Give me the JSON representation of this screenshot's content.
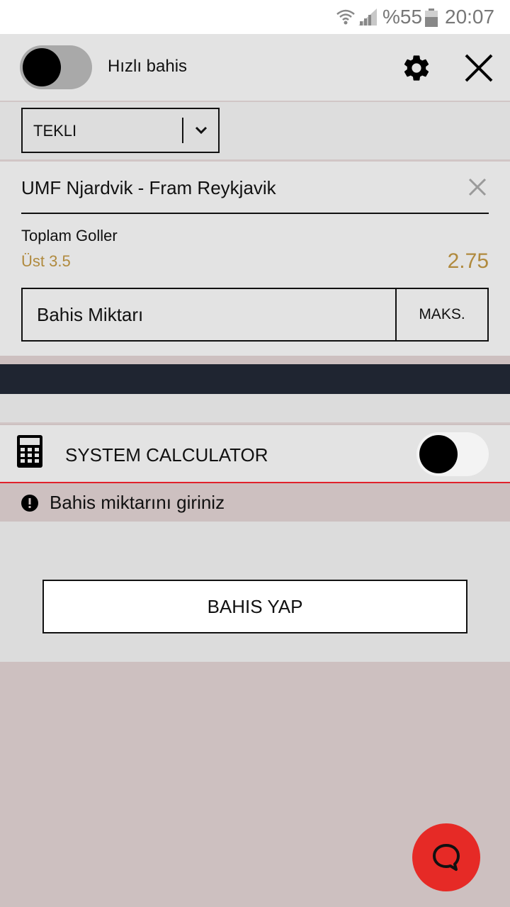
{
  "status_bar": {
    "battery": "%55",
    "time": "20:07"
  },
  "header": {
    "quick_bet_label": "Hızlı bahis",
    "quick_bet_enabled": false
  },
  "bet_type": {
    "selected": "TEKLI"
  },
  "bet": {
    "match": "UMF Njardvik - Fram Reykjavik",
    "market": "Toplam Goller",
    "selection": "Üst 3.5",
    "odds": "2.75",
    "stake_placeholder": "Bahis Miktarı",
    "max_label": "MAKS."
  },
  "system_calculator": {
    "label": "SYSTEM CALCULATOR",
    "enabled": false
  },
  "warning": {
    "text": "Bahis miktarını giriniz"
  },
  "actions": {
    "place_bet_label": "BAHIS YAP"
  },
  "colors": {
    "accent_gold": "#b08a3e",
    "alert_red": "#e0212b",
    "fab_red": "#e62a26",
    "dark_bar": "#1f2531"
  }
}
